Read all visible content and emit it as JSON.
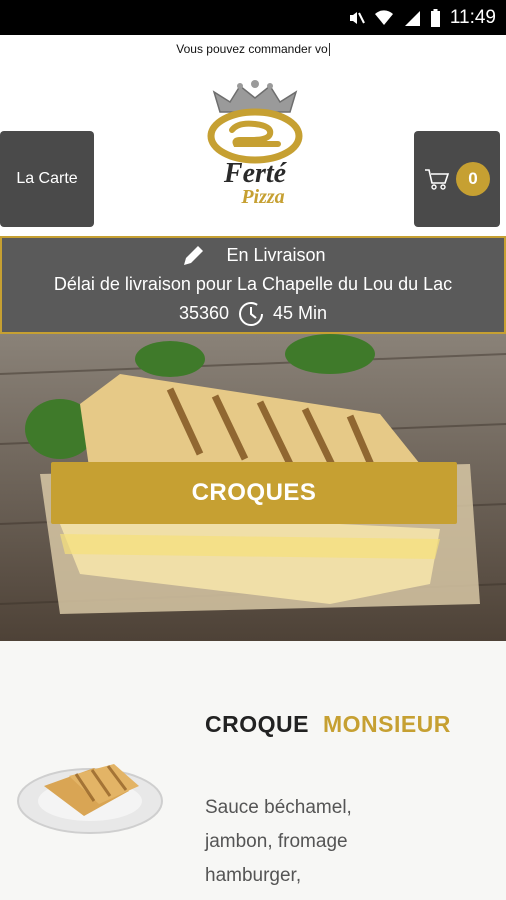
{
  "status_bar": {
    "time": "11:49"
  },
  "header": {
    "marquee_text": "Vous pouvez commander vo",
    "menu_button_label": "La Carte",
    "cart_count": "0",
    "logo_name": "Ferté",
    "logo_sub": "Pizza"
  },
  "delivery": {
    "mode": "En Livraison",
    "text": "Délai de livraison pour La Chapelle du Lou du Lac",
    "postcode": "35360",
    "duration": "45 Min"
  },
  "category": {
    "label": "CROQUES"
  },
  "product": {
    "title_word1": "CROQUE",
    "title_word2": "MONSIEUR",
    "description_lines": [
      "Sauce béchamel,",
      "jambon, fromage",
      "hamburger,"
    ]
  },
  "colors": {
    "accent": "#c6a032",
    "dark_button": "#4a4a4a",
    "delivery_bg": "#5a5a5a"
  }
}
